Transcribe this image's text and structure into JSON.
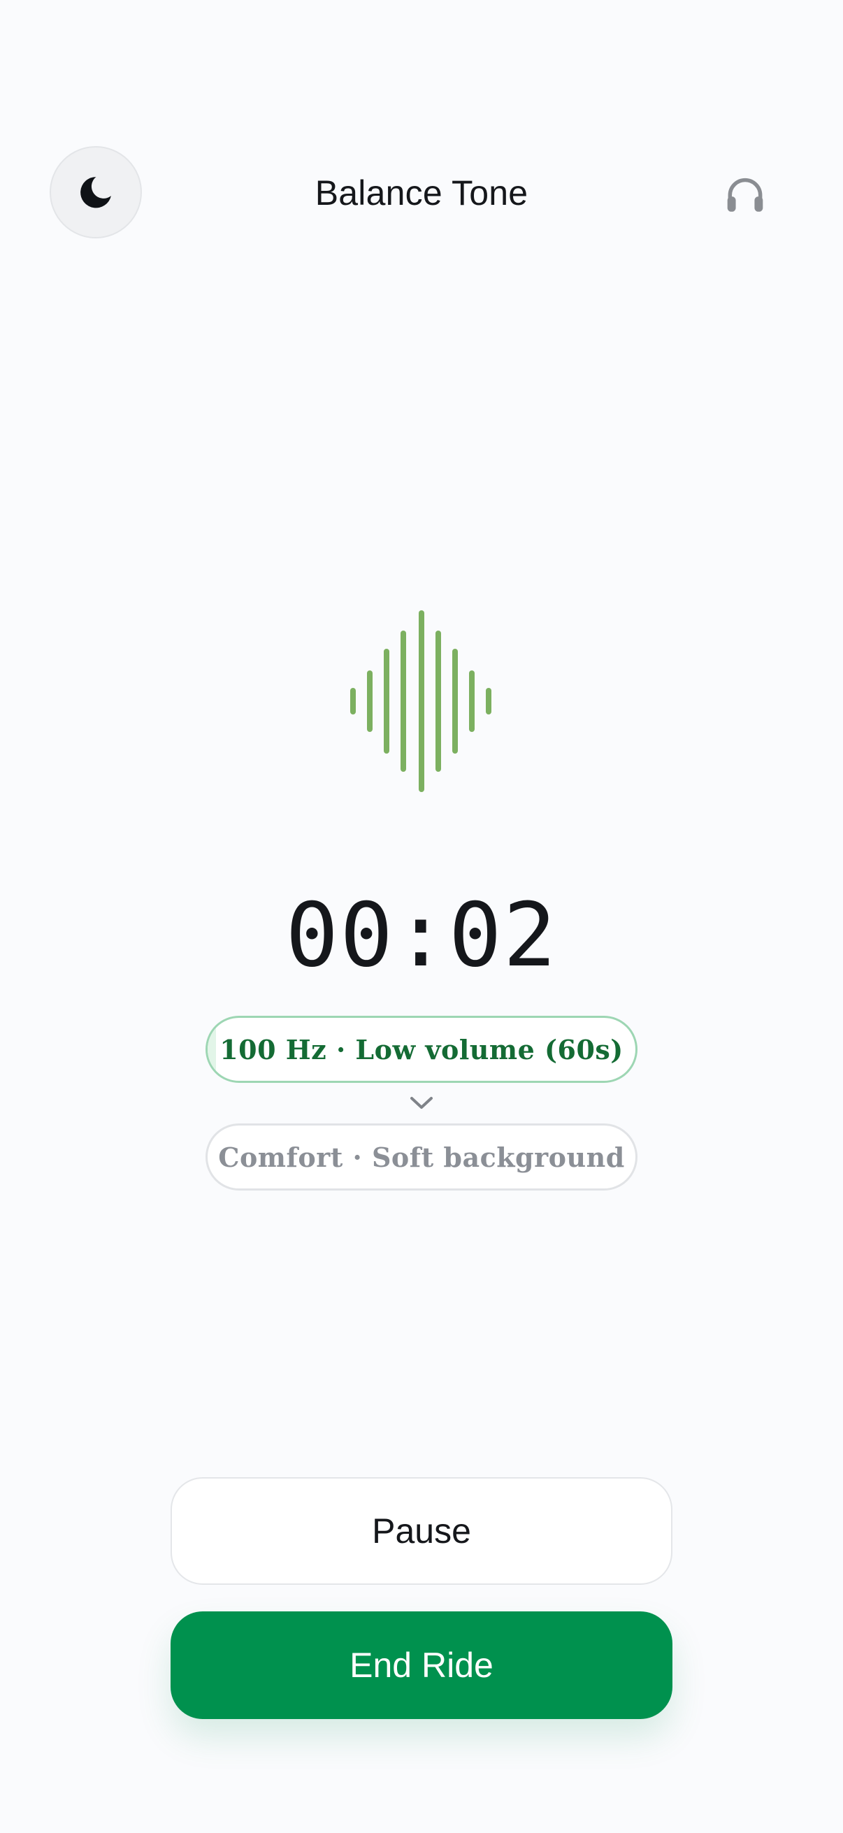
{
  "header": {
    "title": "Balance Tone",
    "theme_toggle_icon": "moon-icon",
    "audio_icon": "headphones-icon"
  },
  "visual": {
    "icon": "waveform-icon",
    "color": "#7cb060"
  },
  "timer": {
    "elapsed": "00:02"
  },
  "phases": {
    "current": "100 Hz · Low volume (60s)",
    "next": "Comfort · Soft background",
    "current_color": "#146b34",
    "current_progress": 0.02
  },
  "controls": {
    "pause_label": "Pause",
    "end_label": "End Ride",
    "accent_color": "#00914e"
  }
}
